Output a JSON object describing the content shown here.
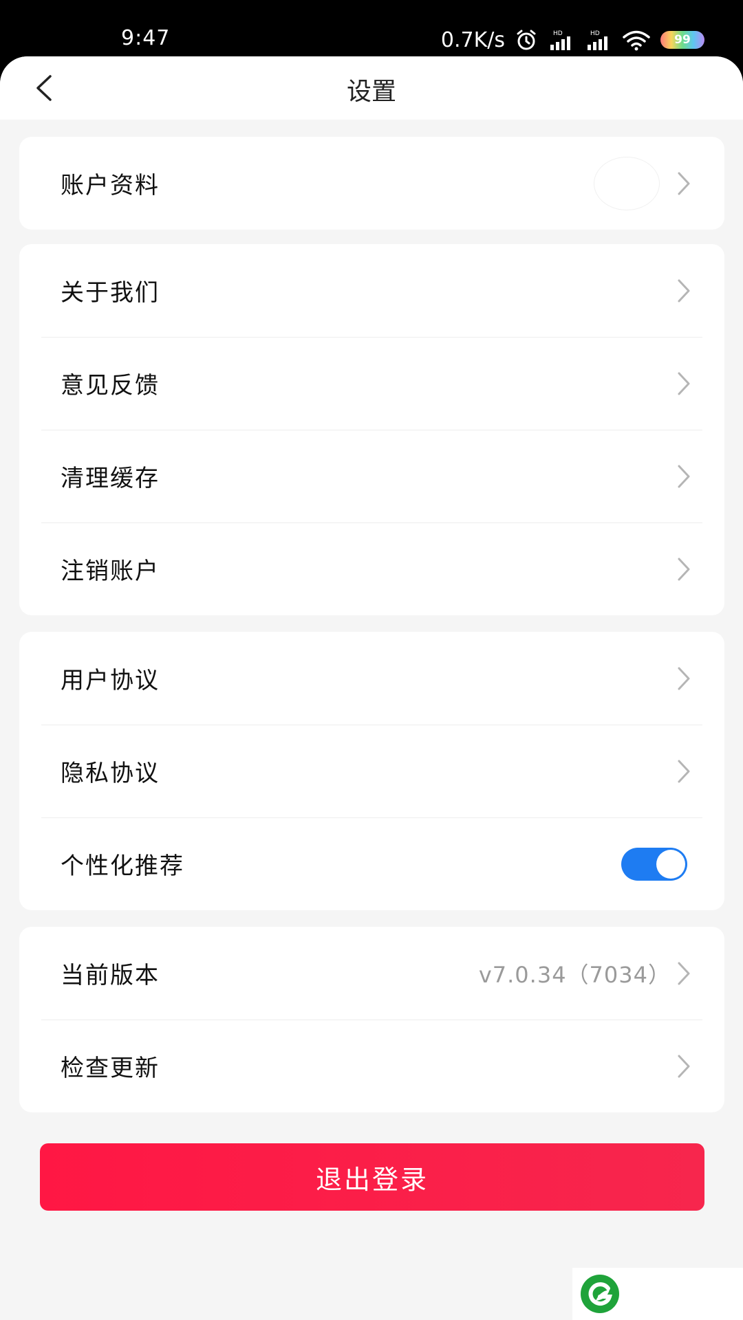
{
  "status_bar": {
    "time": "9:47",
    "network_speed": "0.7K/s",
    "signal_label_1": "HD",
    "signal_label_2": "HD",
    "battery_level": "99"
  },
  "header": {
    "title": "设置"
  },
  "groups": {
    "account": {
      "profile_label": "账户资料"
    },
    "general": {
      "about_label": "关于我们",
      "feedback_label": "意见反馈",
      "clear_cache_label": "清理缓存",
      "delete_account_label": "注销账户"
    },
    "policy": {
      "user_agreement_label": "用户协议",
      "privacy_agreement_label": "隐私协议",
      "personalized_label": "个性化推荐",
      "personalized_enabled": true
    },
    "version": {
      "current_version_label": "当前版本",
      "current_version_value": "v7.0.34（7034）",
      "check_update_label": "检查更新"
    }
  },
  "logout": {
    "label": "退出登录"
  },
  "colors": {
    "accent_red": "#ff1744",
    "toggle_blue": "#1e7cf2",
    "background": "#f5f5f5"
  }
}
